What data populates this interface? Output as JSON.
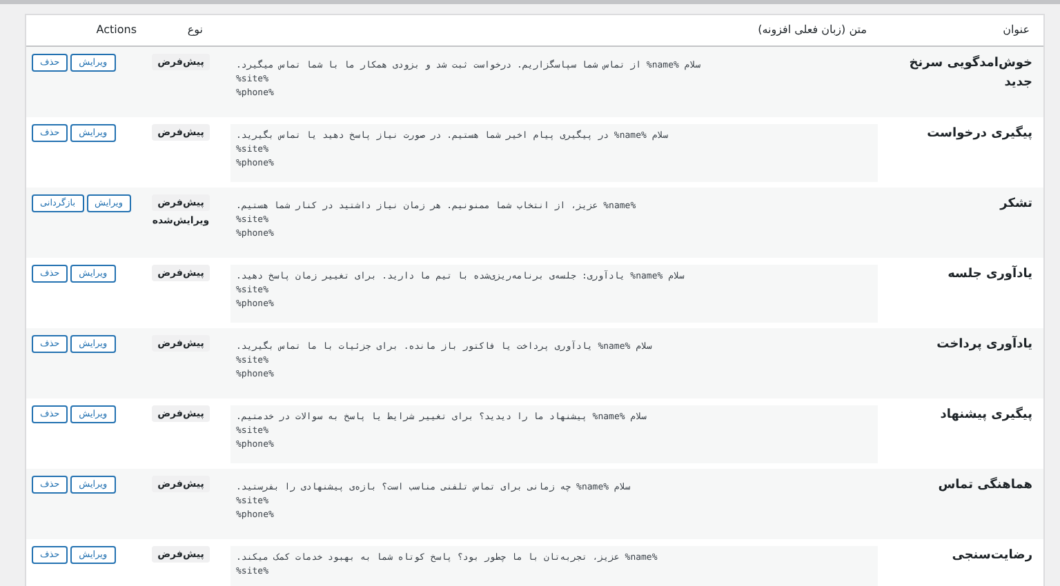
{
  "columns": {
    "title": "عنوان",
    "message": "متن (زبان فعلی افزونه)",
    "type": "نوع",
    "actions": "Actions"
  },
  "rows": [
    {
      "title": "خوش‌امدگویی سرنخ جدید",
      "message_lines": [
        "سلام %name% از تماس شما سپاسگزاریم. درخواست ثبت شد و بزودی همکار ما با شما تماس میگیرد.",
        "%site%",
        "%phone%"
      ],
      "badges": [
        "پیش‌فرض"
      ],
      "actions": [
        "ویرایش",
        "حذف"
      ]
    },
    {
      "title": "پیگیری درخواست",
      "message_lines": [
        "سلام %name% در پیگیری پیام اخیر شما هستیم. در صورت نیاز پاسخ دهید یا تماس بگیرید.",
        "%site%",
        "%phone%"
      ],
      "badges": [
        "پیش‌فرض"
      ],
      "actions": [
        "ویرایش",
        "حذف"
      ]
    },
    {
      "title": "تشکر",
      "message_lines": [
        "%name% عزیز، از انتخاب شما ممنونیم. هر زمان نیاز داشتید در کنار شما هستیم.",
        "%site%",
        "%phone%"
      ],
      "badges": [
        "پیش‌فرض",
        "ویرایش‌شده"
      ],
      "actions": [
        "ویرایش",
        "بازگردانی"
      ]
    },
    {
      "title": "یادآوری جلسه",
      "message_lines": [
        "سلام %name% یادآوری: جلسه‌ی برنامه‌ریزی‌شده با تیم ما دارید. برای تغییر زمان پاسخ دهید.",
        "%site%",
        "%phone%"
      ],
      "badges": [
        "پیش‌فرض"
      ],
      "actions": [
        "ویرایش",
        "حذف"
      ]
    },
    {
      "title": "یادآوری پرداخت",
      "message_lines": [
        "سلام %name% یادآوری پرداخت یا فاکتور باز مانده. برای جزئیات با ما تماس بگیرید.",
        "%site%",
        "%phone%"
      ],
      "badges": [
        "پیش‌فرض"
      ],
      "actions": [
        "ویرایش",
        "حذف"
      ]
    },
    {
      "title": "پیگیری پیشنهاد",
      "message_lines": [
        "سلام %name% پیشنهاد ما را دیدید؟ برای تغییر شرایط یا پاسخ به سوالات در خدمتیم.",
        "%site%",
        "%phone%"
      ],
      "badges": [
        "پیش‌فرض"
      ],
      "actions": [
        "ویرایش",
        "حذف"
      ]
    },
    {
      "title": "هماهنگی تماس",
      "message_lines": [
        "سلام %name% چه زمانی برای تماس تلفنی مناسب است؟ بازه‌ی پیشنهادی را بفرستید.",
        "%site%",
        "%phone%"
      ],
      "badges": [
        "پیش‌فرض"
      ],
      "actions": [
        "ویرایش",
        "حذف"
      ]
    },
    {
      "title": "رضایت‌سنجی",
      "message_lines": [
        "%name% عزیز، تجربه‌تان با ما چطور بود؟ پاسخ کوتاه شما به بهبود خدمات کمک میکند.",
        "%site%"
      ],
      "badges": [
        "پیش‌فرض"
      ],
      "actions": [
        "ویرایش",
        "حذف"
      ]
    }
  ]
}
